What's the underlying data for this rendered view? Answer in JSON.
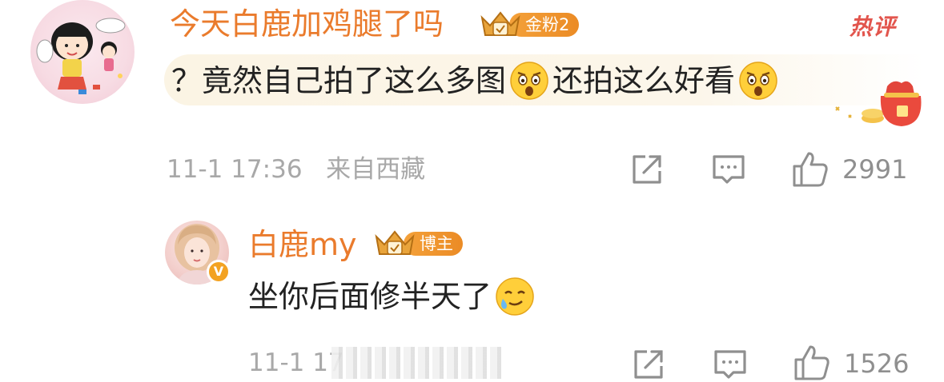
{
  "comment": {
    "username": "今天白鹿加鸡腿了吗",
    "badge": "金粉2",
    "hot_tag": "热评",
    "content_parts": [
      "？竟然自己拍了这么多图",
      "还拍这么好看"
    ],
    "date": "11-1 17:36",
    "location": "来自西藏",
    "like_count": "2991"
  },
  "reply": {
    "username": "白鹿my",
    "badge": "博主",
    "content": "坐你后面修半天了",
    "date_partial": "11-1 17",
    "like_count": "1526"
  },
  "icons": {
    "repost": "share-icon",
    "comment": "comment-icon",
    "like": "thumbs-up-icon",
    "emoji_surprised": "surprised-emoji",
    "emoji_tear": "tear-smile-emoji",
    "crown": "crown-icon",
    "verified": "verified-v-icon"
  },
  "colors": {
    "username": "#ea7b2c",
    "badge_gold": "#f4a13a",
    "hot_tag": "#e2554d",
    "meta_text": "#a8a8a8",
    "icon_gray": "#8f8f8f"
  }
}
